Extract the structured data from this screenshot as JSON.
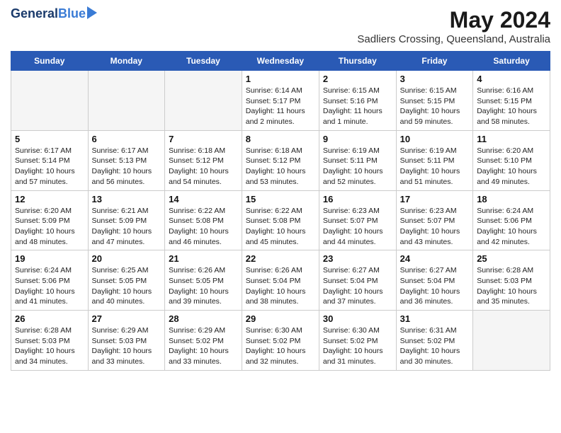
{
  "header": {
    "logo_line1": "General",
    "logo_line2": "Blue",
    "month_year": "May 2024",
    "location": "Sadliers Crossing, Queensland, Australia"
  },
  "weekdays": [
    "Sunday",
    "Monday",
    "Tuesday",
    "Wednesday",
    "Thursday",
    "Friday",
    "Saturday"
  ],
  "weeks": [
    [
      {
        "day": "",
        "empty": true
      },
      {
        "day": "",
        "empty": true
      },
      {
        "day": "",
        "empty": true
      },
      {
        "day": "1",
        "sunrise": "6:14 AM",
        "sunset": "5:17 PM",
        "daylight": "11 hours and 2 minutes."
      },
      {
        "day": "2",
        "sunrise": "6:15 AM",
        "sunset": "5:16 PM",
        "daylight": "11 hours and 1 minute."
      },
      {
        "day": "3",
        "sunrise": "6:15 AM",
        "sunset": "5:15 PM",
        "daylight": "10 hours and 59 minutes."
      },
      {
        "day": "4",
        "sunrise": "6:16 AM",
        "sunset": "5:15 PM",
        "daylight": "10 hours and 58 minutes."
      }
    ],
    [
      {
        "day": "5",
        "sunrise": "6:17 AM",
        "sunset": "5:14 PM",
        "daylight": "10 hours and 57 minutes."
      },
      {
        "day": "6",
        "sunrise": "6:17 AM",
        "sunset": "5:13 PM",
        "daylight": "10 hours and 56 minutes."
      },
      {
        "day": "7",
        "sunrise": "6:18 AM",
        "sunset": "5:12 PM",
        "daylight": "10 hours and 54 minutes."
      },
      {
        "day": "8",
        "sunrise": "6:18 AM",
        "sunset": "5:12 PM",
        "daylight": "10 hours and 53 minutes."
      },
      {
        "day": "9",
        "sunrise": "6:19 AM",
        "sunset": "5:11 PM",
        "daylight": "10 hours and 52 minutes."
      },
      {
        "day": "10",
        "sunrise": "6:19 AM",
        "sunset": "5:11 PM",
        "daylight": "10 hours and 51 minutes."
      },
      {
        "day": "11",
        "sunrise": "6:20 AM",
        "sunset": "5:10 PM",
        "daylight": "10 hours and 49 minutes."
      }
    ],
    [
      {
        "day": "12",
        "sunrise": "6:20 AM",
        "sunset": "5:09 PM",
        "daylight": "10 hours and 48 minutes."
      },
      {
        "day": "13",
        "sunrise": "6:21 AM",
        "sunset": "5:09 PM",
        "daylight": "10 hours and 47 minutes."
      },
      {
        "day": "14",
        "sunrise": "6:22 AM",
        "sunset": "5:08 PM",
        "daylight": "10 hours and 46 minutes."
      },
      {
        "day": "15",
        "sunrise": "6:22 AM",
        "sunset": "5:08 PM",
        "daylight": "10 hours and 45 minutes."
      },
      {
        "day": "16",
        "sunrise": "6:23 AM",
        "sunset": "5:07 PM",
        "daylight": "10 hours and 44 minutes."
      },
      {
        "day": "17",
        "sunrise": "6:23 AM",
        "sunset": "5:07 PM",
        "daylight": "10 hours and 43 minutes."
      },
      {
        "day": "18",
        "sunrise": "6:24 AM",
        "sunset": "5:06 PM",
        "daylight": "10 hours and 42 minutes."
      }
    ],
    [
      {
        "day": "19",
        "sunrise": "6:24 AM",
        "sunset": "5:06 PM",
        "daylight": "10 hours and 41 minutes."
      },
      {
        "day": "20",
        "sunrise": "6:25 AM",
        "sunset": "5:05 PM",
        "daylight": "10 hours and 40 minutes."
      },
      {
        "day": "21",
        "sunrise": "6:26 AM",
        "sunset": "5:05 PM",
        "daylight": "10 hours and 39 minutes."
      },
      {
        "day": "22",
        "sunrise": "6:26 AM",
        "sunset": "5:04 PM",
        "daylight": "10 hours and 38 minutes."
      },
      {
        "day": "23",
        "sunrise": "6:27 AM",
        "sunset": "5:04 PM",
        "daylight": "10 hours and 37 minutes."
      },
      {
        "day": "24",
        "sunrise": "6:27 AM",
        "sunset": "5:04 PM",
        "daylight": "10 hours and 36 minutes."
      },
      {
        "day": "25",
        "sunrise": "6:28 AM",
        "sunset": "5:03 PM",
        "daylight": "10 hours and 35 minutes."
      }
    ],
    [
      {
        "day": "26",
        "sunrise": "6:28 AM",
        "sunset": "5:03 PM",
        "daylight": "10 hours and 34 minutes."
      },
      {
        "day": "27",
        "sunrise": "6:29 AM",
        "sunset": "5:03 PM",
        "daylight": "10 hours and 33 minutes."
      },
      {
        "day": "28",
        "sunrise": "6:29 AM",
        "sunset": "5:02 PM",
        "daylight": "10 hours and 33 minutes."
      },
      {
        "day": "29",
        "sunrise": "6:30 AM",
        "sunset": "5:02 PM",
        "daylight": "10 hours and 32 minutes."
      },
      {
        "day": "30",
        "sunrise": "6:30 AM",
        "sunset": "5:02 PM",
        "daylight": "10 hours and 31 minutes."
      },
      {
        "day": "31",
        "sunrise": "6:31 AM",
        "sunset": "5:02 PM",
        "daylight": "10 hours and 30 minutes."
      },
      {
        "day": "",
        "empty": true
      }
    ]
  ]
}
